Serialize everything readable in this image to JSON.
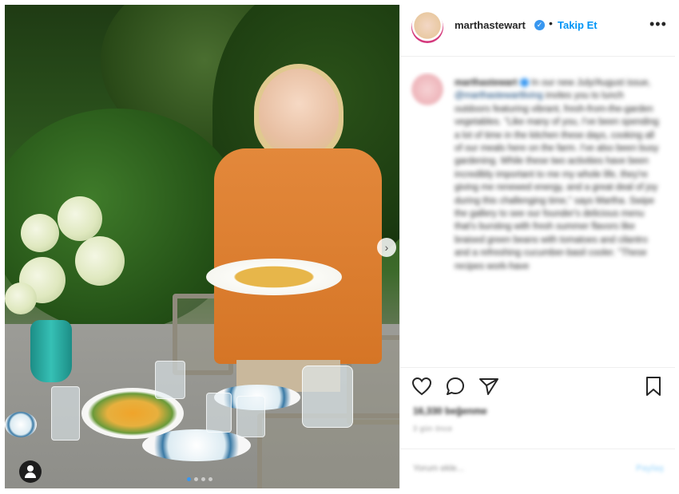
{
  "post": {
    "photo_alt": "",
    "carousel_arrow": "›",
    "dots_count": 4
  },
  "header": {
    "username": "marthastewart",
    "verified_icon": "verified-badge-icon",
    "separator": "•",
    "follow_label": "Takip Et",
    "more_label": "•••"
  },
  "caption": {
    "username": "marthastewart",
    "text_part1": " In our new July/August issue, ",
    "mention": "@marthastewartliving",
    "text_part2": " invites you to lunch outdoors featuring vibrant, fresh-from-the-garden vegetables. \"Like many of you, I've been spending a lot of time in the kitchen these days, cooking all of our meals here on the farm. I've also been busy gardening. While these two activities have been incredibly important to me my whole life, they're giving me renewed energy, and a great deal of joy during this challenging time,\" says Martha. Swipe the gallery to see our founder's delicious menu that's bursting with fresh summer flavors like braised green beans with tomatoes and cilantro and a refreshing cucumber-basil cooler. \"These recipes work-have"
  },
  "actions": {
    "like_icon": "heart-icon",
    "comment_icon": "comment-icon",
    "share_icon": "share-icon",
    "save_icon": "bookmark-icon"
  },
  "likes_text": "16,330 beğenme",
  "time_text": "3 gün önce",
  "comment": {
    "placeholder": "Yorum ekle...",
    "post_label": "Paylaş"
  },
  "colors": {
    "accent": "#0095f6",
    "verified": "#3897f0",
    "text": "#262626"
  }
}
